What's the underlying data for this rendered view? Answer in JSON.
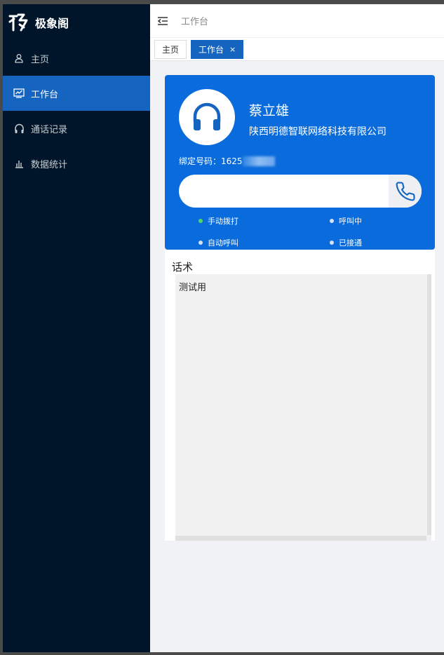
{
  "app": {
    "name": "极象阁",
    "logo_icon": "logo-mark-icon"
  },
  "sidebar": {
    "items": [
      {
        "label": "主页",
        "icon": "user-icon",
        "active": false
      },
      {
        "label": "工作台",
        "icon": "dashboard-chart-icon",
        "active": true
      },
      {
        "label": "通话记录",
        "icon": "headphones-icon",
        "active": false
      },
      {
        "label": "数据统计",
        "icon": "bar-chart-icon",
        "active": false
      }
    ]
  },
  "header": {
    "breadcrumb": "工作台",
    "fold_icon": "menu-fold-icon"
  },
  "tabs": [
    {
      "label": "主页",
      "active": false
    },
    {
      "label": "工作台",
      "active": true,
      "close": "×"
    }
  ],
  "agent": {
    "name": "蔡立雄",
    "company": "陕西明德智联网络科技有限公司",
    "bind_label": "绑定号码：",
    "bind_number": "1625"
  },
  "dialer": {
    "value": "",
    "placeholder": ""
  },
  "legend": [
    {
      "label": "手动拨打",
      "color": "#4cd964"
    },
    {
      "label": "呼叫中",
      "color": "#d6e3f5"
    },
    {
      "label": "自动呼叫",
      "color": "#d6e3f5"
    },
    {
      "label": "已接通",
      "color": "#d6e3f5"
    }
  ],
  "script": {
    "title": "话术",
    "content": "测试用"
  },
  "colors": {
    "sidebar": "#001529",
    "accent": "#1565c0",
    "card": "#0a6cdc"
  }
}
